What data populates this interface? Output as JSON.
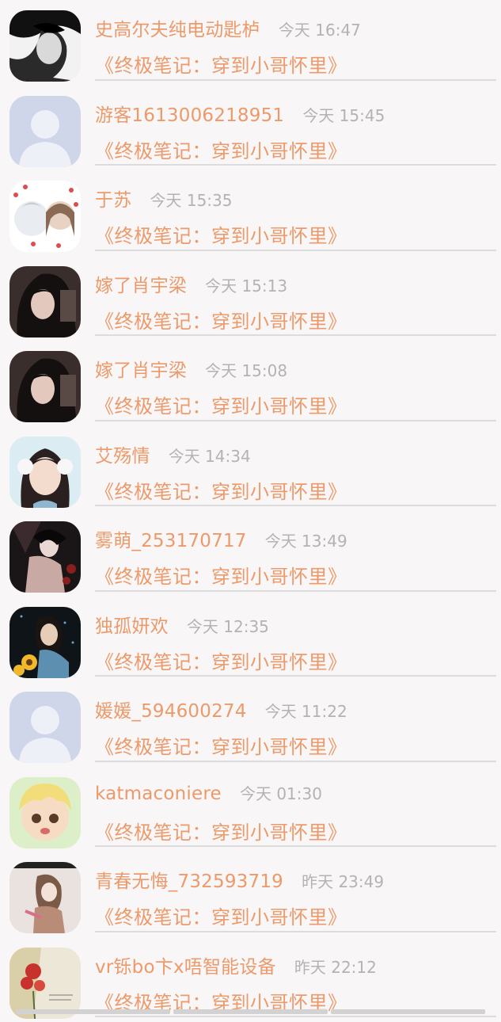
{
  "comments": [
    {
      "user": "史高尔夫纯电动匙栌",
      "time": "今天 16:47",
      "book": "《终极笔记：穿到小哥怀里》",
      "avatar": "dark-portrait-avatar"
    },
    {
      "user": "游客1613006218951",
      "time": "今天 15:45",
      "book": "《终极笔记：穿到小哥怀里》",
      "avatar": "default-user-avatar"
    },
    {
      "user": "于苏",
      "time": "今天 15:35",
      "book": "《终极笔记：穿到小哥怀里》",
      "avatar": "anime-pair-avatar"
    },
    {
      "user": "嫁了肖宇梁",
      "time": "今天 15:13",
      "book": "《终极笔记：穿到小哥怀里》",
      "avatar": "girl-portrait-avatar"
    },
    {
      "user": "嫁了肖宇梁",
      "time": "今天 15:08",
      "book": "《终极笔记：穿到小哥怀里》",
      "avatar": "girl-portrait-avatar"
    },
    {
      "user": "艾殇情",
      "time": "今天 14:34",
      "book": "《终极笔记：穿到小哥怀里》",
      "avatar": "anime-earmuff-avatar"
    },
    {
      "user": "雾萌_253170717",
      "time": "今天 13:49",
      "book": "《终极笔记：穿到小哥怀里》",
      "avatar": "anime-dark-avatar"
    },
    {
      "user": "独孤妍欢",
      "time": "今天 12:35",
      "book": "《终极笔记：穿到小哥怀里》",
      "avatar": "sunflower-girl-avatar"
    },
    {
      "user": "媛媛_594600274",
      "time": "今天 11:22",
      "book": "《终极笔记：穿到小哥怀里》",
      "avatar": "default-user-avatar"
    },
    {
      "user": "katmaconiere",
      "time": "今天 01:30",
      "book": "《终极笔记：穿到小哥怀里》",
      "avatar": "cartoon-boy-avatar"
    },
    {
      "user": "青春无悔_732593719",
      "time": "昨天 23:49",
      "book": "《终极笔记：穿到小哥怀里》",
      "avatar": "sketch-girl-avatar"
    },
    {
      "user": "vr铄bo卞x唔智能设备",
      "time": "昨天 22:12",
      "book": "《终极笔记：穿到小哥怀里》",
      "avatar": "red-flower-avatar"
    }
  ],
  "colors": {
    "accent": "#ec9a6a",
    "time": "#b3b3b3",
    "divider": "#dcdcdc",
    "background": "#f8f6f7"
  }
}
